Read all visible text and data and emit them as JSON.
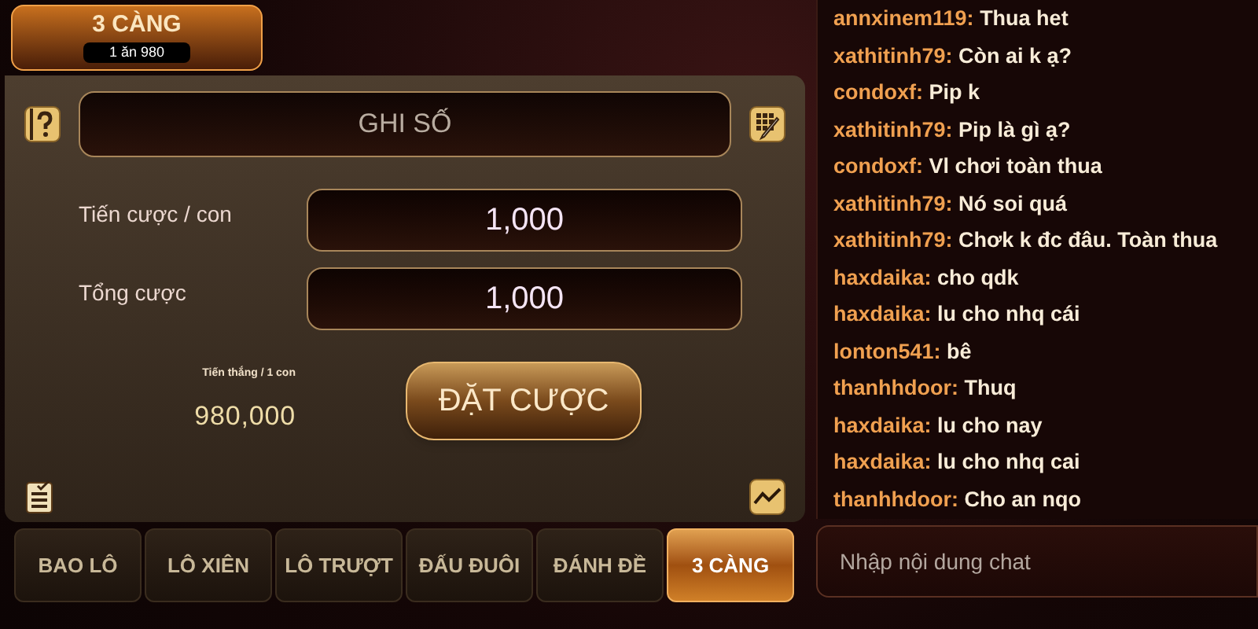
{
  "header": {
    "title": "3 CÀNG",
    "subtitle": "1 ăn 980"
  },
  "number_field": {
    "placeholder": "GHI SỐ"
  },
  "fields": [
    {
      "label": "Tiến cược / con",
      "value": "1,000"
    },
    {
      "label": "Tổng cược",
      "value": "1,000"
    }
  ],
  "winnings": {
    "label": "Tiến thắng / 1 con",
    "value": "980,000"
  },
  "bet_button": "ĐẶT CƯỢC",
  "tabs": [
    {
      "label": "BAO LÔ",
      "selected": false
    },
    {
      "label": "LÔ XIÊN",
      "selected": false
    },
    {
      "label": "LÔ TRƯỢT",
      "selected": false
    },
    {
      "label": "ĐẤU ĐUÔI",
      "selected": false
    },
    {
      "label": "ĐÁNH ĐỀ",
      "selected": false
    },
    {
      "label": "3 CÀNG",
      "selected": true
    }
  ],
  "chat": {
    "messages": [
      {
        "user": "annxinem119:",
        "text": "Thua het"
      },
      {
        "user": "xathitinh79:",
        "text": "Còn ai k ạ?"
      },
      {
        "user": "condoxf:",
        "text": "Pip k"
      },
      {
        "user": "xathitinh79:",
        "text": "Pip là gì ạ?"
      },
      {
        "user": "condoxf:",
        "text": "Vl chơi toàn thua"
      },
      {
        "user": "xathitinh79:",
        "text": "Nó soi quá"
      },
      {
        "user": "xathitinh79:",
        "text": "Chơk k đc đâu. Toàn thua"
      },
      {
        "user": "haxdaika:",
        "text": "cho qdk"
      },
      {
        "user": "haxdaika:",
        "text": "lu cho nhq cái"
      },
      {
        "user": "lonton541:",
        "text": "bê"
      },
      {
        "user": "thanhhdoor:",
        "text": "Thuq"
      },
      {
        "user": "haxdaika:",
        "text": "lu cho nay"
      },
      {
        "user": "haxdaika:",
        "text": "lu cho nhq cai"
      },
      {
        "user": "thanhhdoor:",
        "text": "Cho an nqo"
      }
    ],
    "input": {
      "placeholder": "Nhập nội dung chat"
    }
  }
}
